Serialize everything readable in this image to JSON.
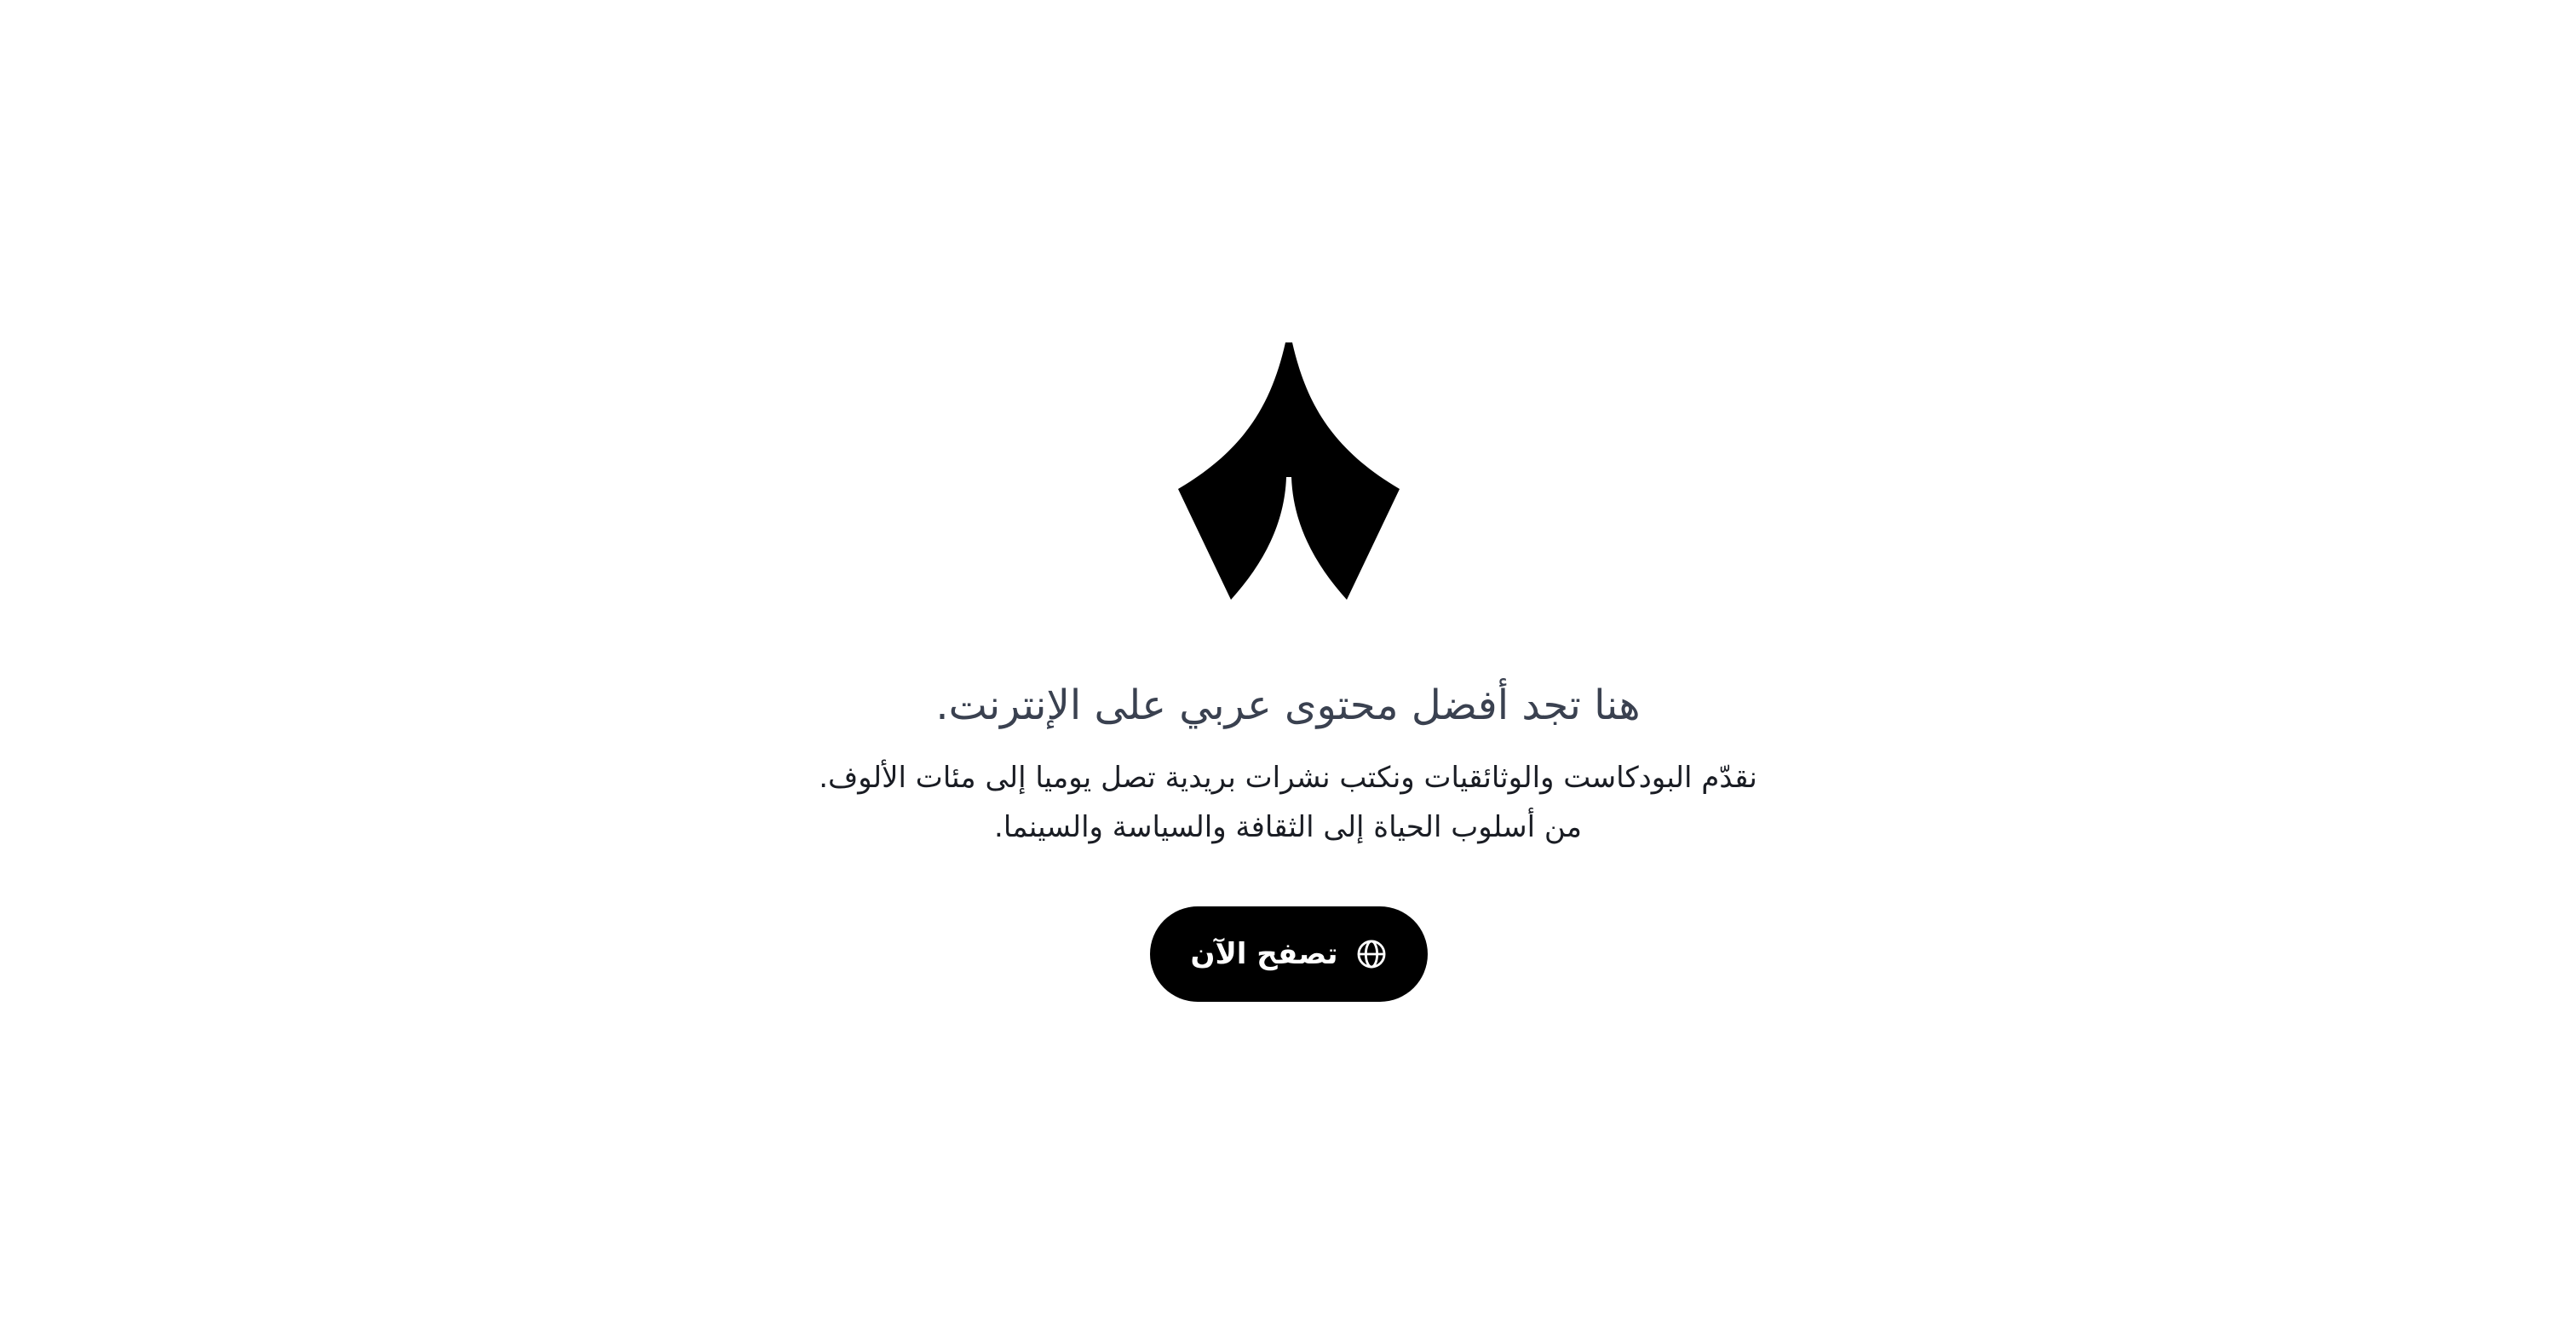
{
  "hero": {
    "headline": "هنا تجد أفضل محتوى عربي على الإنترنت.",
    "description_line_1": "نقدّم البودكاست والوثائقيات ونكتب نشرات بريدية تصل يوميا إلى مئات الألوف.",
    "description_line_2": "من أسلوب الحياة إلى الثقافة والسياسة والسينما.",
    "cta_label": "تصفح الآن",
    "cta_icon": "globe-icon",
    "logo_icon": "brand-logo-icon"
  },
  "colors": {
    "background": "#ffffff",
    "headline": "#3a4150",
    "body_text": "#1a1d24",
    "button_bg": "#000000",
    "button_text": "#ffffff"
  }
}
